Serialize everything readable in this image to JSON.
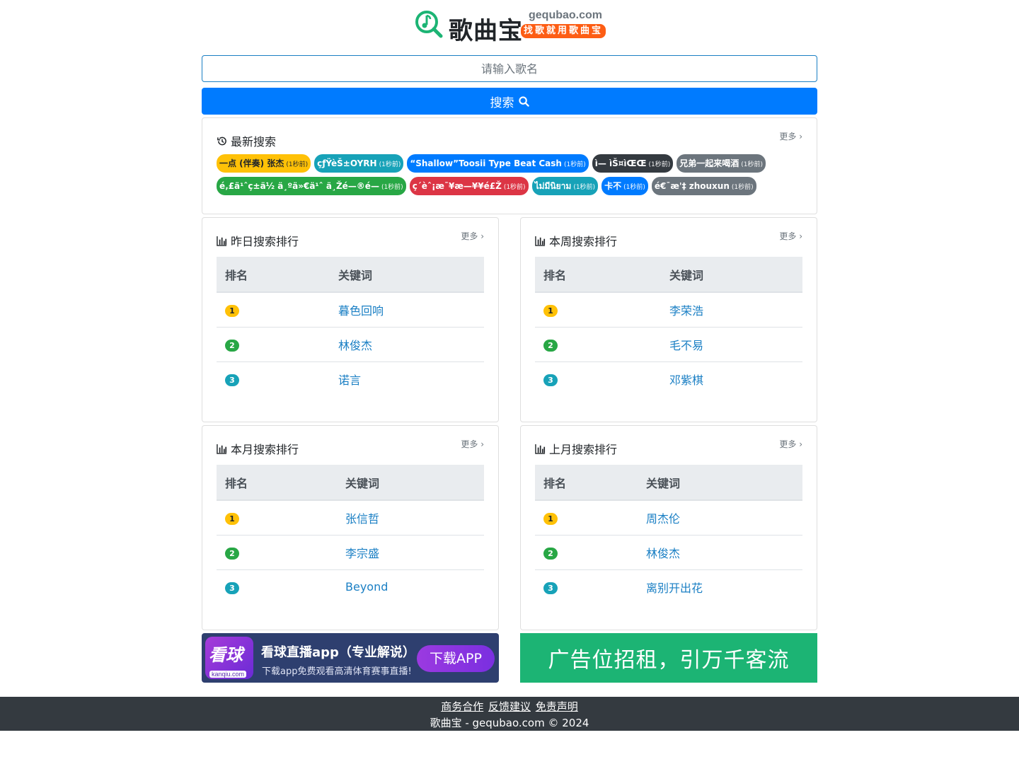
{
  "header": {
    "title": "歌曲宝",
    "domain": "gequbao.com",
    "slogan": "找歌就用歌曲宝"
  },
  "search": {
    "placeholder": "请输入歌名",
    "button_label": "搜索"
  },
  "colors": {
    "primary": "#007bff",
    "warning": "#ffc107",
    "success": "#28a745",
    "info": "#17a2b8",
    "danger": "#dc3545",
    "dark": "#343a40",
    "secondary": "#6c757d",
    "link": "#1a7fc4"
  },
  "recent": {
    "title": "最新搜索",
    "more": "更多",
    "rows": [
      [
        {
          "text": "一点 (伴奏) 张杰",
          "ago": "(1秒前)",
          "color": "#ffc107",
          "dark_text": true
        },
        {
          "text": "çƒŸèŠ±OYRH",
          "ago": "(1秒前)",
          "color": "#17a2b8"
        },
        {
          "text": "“Shallow”Toosii Type Beat Cash",
          "ago": "(1秒前)",
          "color": "#007bff"
        },
        {
          "text": "ì— ìŠ¤ìŒŒ",
          "ago": "(1秒前)",
          "color": "#343a40"
        },
        {
          "text": "兄弟一起来喝酒",
          "ago": "(1秒前)",
          "color": "#6c757d"
        }
      ],
      [
        {
          "text": "é‚£ä¹ˆç±ä½ ä¸ºä»€ä¹ˆ ä¸Žé—®é—",
          "ago": "(1秒前)",
          "color": "#28a745"
        },
        {
          "text": "ç´èˆ¡æ¯¥æ—¥¥é£Ž",
          "ago": "(1秒前)",
          "color": "#dc3545"
        },
        {
          "text": "ไม่มีนิยาม",
          "ago": "(1秒前)",
          "color": "#17a2b8"
        },
        {
          "text": "卡不",
          "ago": "(1秒前)",
          "color": "#007bff"
        },
        {
          "text": "é€¯æ'‡ zhouxun",
          "ago": "(1秒前)",
          "color": "#6c757d"
        }
      ]
    ]
  },
  "rankings": [
    {
      "title": "昨日搜索排行",
      "more": "更多",
      "col_rank": "排名",
      "col_keyword": "关键词",
      "rows": [
        {
          "rank": "1",
          "keyword": "暮色回响"
        },
        {
          "rank": "2",
          "keyword": "林俊杰"
        },
        {
          "rank": "3",
          "keyword": "诺言"
        }
      ]
    },
    {
      "title": "本周搜索排行",
      "more": "更多",
      "col_rank": "排名",
      "col_keyword": "关键词",
      "rows": [
        {
          "rank": "1",
          "keyword": "李荣浩"
        },
        {
          "rank": "2",
          "keyword": "毛不易"
        },
        {
          "rank": "3",
          "keyword": "邓紫棋"
        }
      ]
    },
    {
      "title": "本月搜索排行",
      "more": "更多",
      "col_rank": "排名",
      "col_keyword": "关键词",
      "rows": [
        {
          "rank": "1",
          "keyword": "张信哲"
        },
        {
          "rank": "2",
          "keyword": "李宗盛"
        },
        {
          "rank": "3",
          "keyword": "Beyond"
        }
      ]
    },
    {
      "title": "上月搜索排行",
      "more": "更多",
      "col_rank": "排名",
      "col_keyword": "关键词",
      "rows": [
        {
          "rank": "1",
          "keyword": "周杰伦"
        },
        {
          "rank": "2",
          "keyword": "林俊杰"
        },
        {
          "rank": "3",
          "keyword": "离别开出花"
        }
      ]
    }
  ],
  "ads": {
    "left": {
      "icon_text": "看球",
      "icon_sub": "kanqiu.com",
      "title": "看球直播app（专业解说）",
      "subtitle": "下载app免费观看高清体育赛事直播!",
      "button": "下载APP"
    },
    "right": {
      "text": "广告位招租，引万千客流"
    }
  },
  "footer": {
    "links": [
      "商务合作",
      "反馈建议",
      "免责声明"
    ],
    "copyright": "歌曲宝 - gequbao.com © 2024"
  }
}
